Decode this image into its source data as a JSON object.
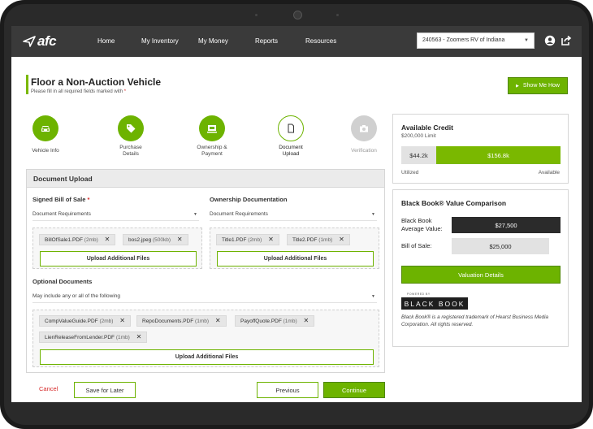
{
  "nav": {
    "logo": "afc",
    "items": [
      "Home",
      "My Inventory",
      "My Money",
      "Reports",
      "Resources"
    ],
    "dealer": "240563 - Zoomers RV of Indiana"
  },
  "header": {
    "title": "Floor a Non-Auction Vehicle",
    "subtitle": "Please fill in all required fields marked with",
    "required_mark": "*",
    "show_me_how": "Show Me How"
  },
  "steps": [
    {
      "label": "Vehicle Info",
      "state": "done",
      "icon": "car-icon"
    },
    {
      "label": "Purchase Details",
      "state": "done",
      "icon": "tag-icon"
    },
    {
      "label": "Ownership & Payment",
      "state": "done",
      "icon": "payment-icon"
    },
    {
      "label": "Document Upload",
      "state": "current",
      "icon": "document-icon"
    },
    {
      "label": "Verification",
      "state": "pending",
      "icon": "camera-icon"
    }
  ],
  "upload": {
    "title": "Document Upload",
    "bill_of_sale": {
      "label": "Signed Bill of Sale",
      "required": "*",
      "requirements": "Document Requirements",
      "files": [
        {
          "name": "BillOfSale1.PDF",
          "size": "(2mb)"
        },
        {
          "name": "bos2.jpeg",
          "size": "(500kb)"
        }
      ],
      "upload_label": "Upload Additional Files"
    },
    "ownership": {
      "label": "Ownership Documentation",
      "requirements": "Document Requirements",
      "files": [
        {
          "name": "Title1.PDF",
          "size": "(2mb)"
        },
        {
          "name": "Title2.PDF",
          "size": "(1mb)"
        }
      ],
      "upload_label": "Upload Additional Files"
    },
    "optional": {
      "label": "Optional Documents",
      "requirements": "May include any or all of the following",
      "files": [
        {
          "name": "CompValueGuide.PDF",
          "size": "(2mb)"
        },
        {
          "name": "RepoDocuments.PDF",
          "size": "(1mb)"
        },
        {
          "name": "PayoffQuote.PDF",
          "size": "(1mb)"
        },
        {
          "name": "LienReleaseFromLender.PDF",
          "size": "(1mb)"
        }
      ],
      "upload_label": "Upload Additional Files"
    }
  },
  "actions": {
    "cancel": "Cancel",
    "save": "Save for Later",
    "previous": "Previous",
    "continue": "Continue"
  },
  "credit": {
    "title": "Available Credit",
    "limit": "$200,000 Limit",
    "utilized_value": "$44.2k",
    "available_value": "$156.8k",
    "utilized_label": "Utilized",
    "available_label": "Available",
    "utilized_fraction": 0.221
  },
  "blackbook": {
    "title": "Black Book® Value Comparison",
    "avg_label": "Black Book Average Value:",
    "avg_value": "$27,500",
    "sale_label": "Bill of Sale:",
    "sale_value": "$25,000",
    "details_button": "Valuation Details",
    "powered_by": "POWERED BY",
    "logo_text": "BLACK BOOK",
    "note": "Black Book® is a registered trademark of Hearst Business Media Corporation. All rights reserved."
  },
  "colors": {
    "accent": "#6db300",
    "nav_bg": "#3a3a3a",
    "required": "#d62828"
  }
}
